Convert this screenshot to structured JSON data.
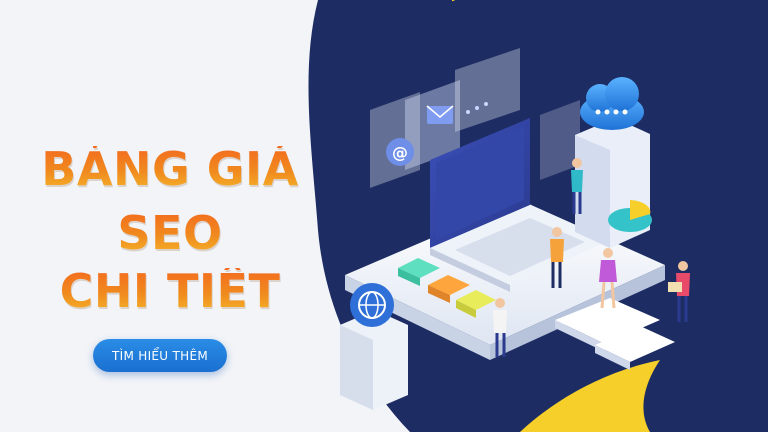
{
  "banner": {
    "headline": [
      "BẢNG GIÁ",
      "SEO",
      "CHI TIẾT"
    ],
    "cta_label": "TÌM HIỂU THÊM"
  },
  "colors": {
    "navy": "#1d2d64",
    "accent_orange": "#f36a1f",
    "accent_yellow": "#f6cf2a",
    "button_blue": "#1f7ad8"
  },
  "icons": [
    "email-icon",
    "at-sign-icon",
    "cloud-icon",
    "globe-icon",
    "pie-chart-icon",
    "laptop-icon"
  ]
}
